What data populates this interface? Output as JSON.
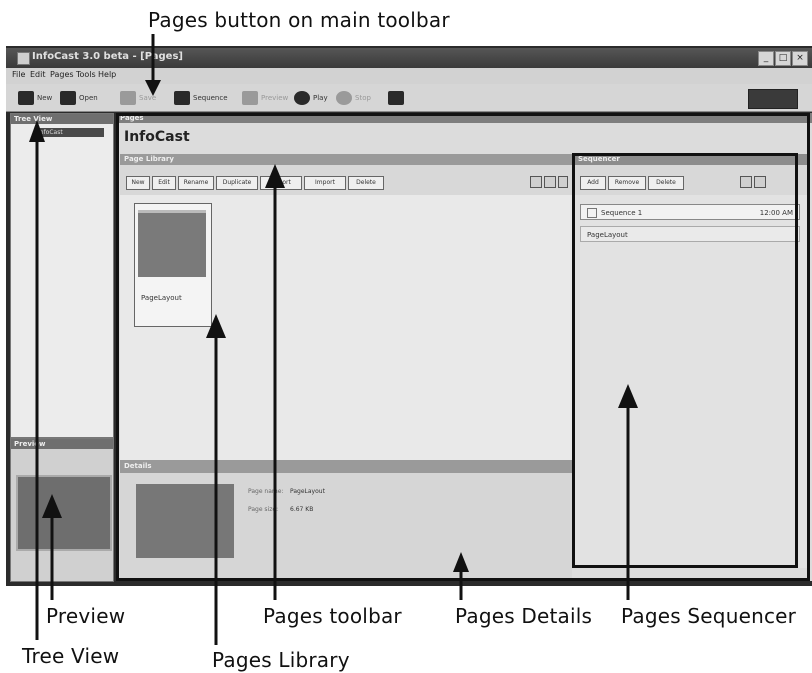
{
  "callouts": {
    "pages_button": "Pages button on main toolbar",
    "preview": "Preview",
    "tree_view": "Tree View",
    "pages_toolbar": "Pages toolbar",
    "pages_library": "Pages Library",
    "pages_details": "Pages Details",
    "pages_sequencer": "Pages Sequencer"
  },
  "window": {
    "title": "InfoCast 3.0 beta - [Pages]",
    "min": "_",
    "max": "□",
    "close": "×"
  },
  "menu": [
    "File",
    "Edit",
    "Pages",
    "Tools",
    "Help"
  ],
  "main_toolbar": {
    "new": "New",
    "open": "Open",
    "save": "Save",
    "sequence": "Sequence",
    "preview": "Preview",
    "play": "Play",
    "stop": "Stop"
  },
  "tree_view": {
    "header": "Tree View",
    "selected_item": "InfoCast"
  },
  "preview_panel": {
    "header": "Preview"
  },
  "pages": {
    "header": "Pages",
    "title": "InfoCast",
    "library_header": "Page Library",
    "toolbar": [
      "New",
      "Edit",
      "Rename",
      "Duplicate",
      "Export",
      "Import",
      "Delete"
    ],
    "thumbnail_label": "PageLayout"
  },
  "details": {
    "header": "Details",
    "name_label": "Page name:",
    "name_value": "PageLayout",
    "size_label": "Page size:",
    "size_value": "6.67 KB"
  },
  "sequencer": {
    "header": "Sequencer",
    "toolbar": [
      "Add",
      "Remove",
      "Delete"
    ],
    "sequence_name": "Sequence 1",
    "sequence_time": "12:00 AM",
    "page_name": "PageLayout"
  }
}
